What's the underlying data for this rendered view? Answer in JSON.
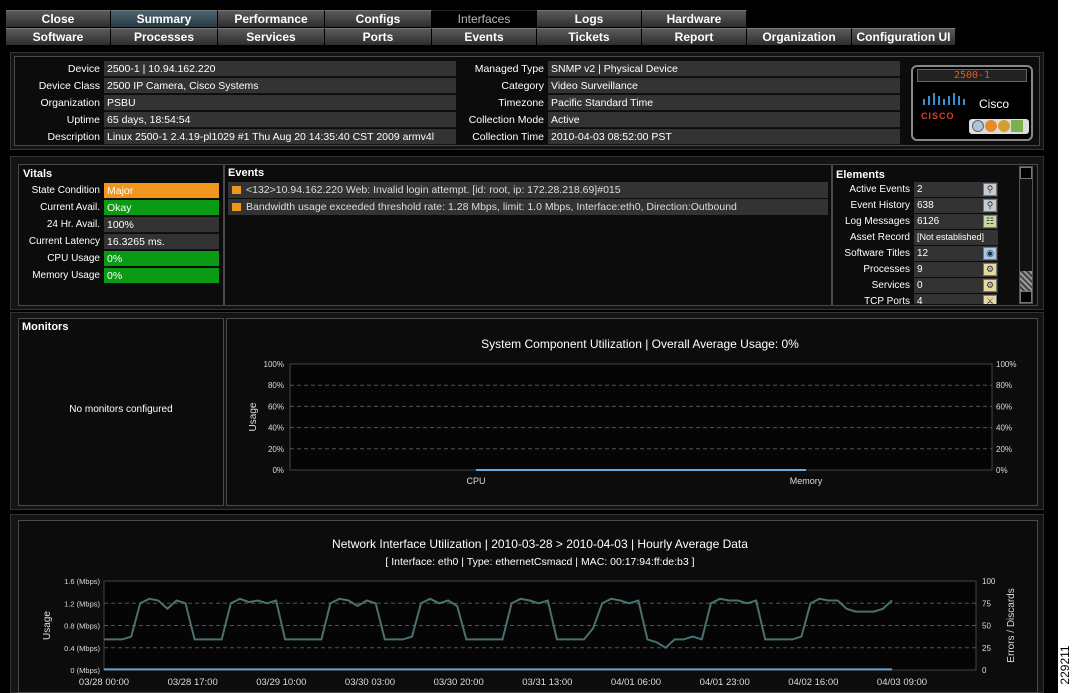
{
  "tabs_row1": [
    {
      "label": "Close",
      "state": "normal"
    },
    {
      "label": "Summary",
      "state": "selected"
    },
    {
      "label": "Performance",
      "state": "normal"
    },
    {
      "label": "Configs",
      "state": "normal"
    },
    {
      "label": "Interfaces",
      "state": "inactive"
    },
    {
      "label": "Logs",
      "state": "normal"
    },
    {
      "label": "Hardware",
      "state": "normal"
    }
  ],
  "tabs_row2": [
    {
      "label": "Software",
      "state": "normal"
    },
    {
      "label": "Processes",
      "state": "normal"
    },
    {
      "label": "Services",
      "state": "normal"
    },
    {
      "label": "Ports",
      "state": "normal"
    },
    {
      "label": "Events",
      "state": "normal"
    },
    {
      "label": "Tickets",
      "state": "normal"
    },
    {
      "label": "Report",
      "state": "normal"
    },
    {
      "label": "Organization",
      "state": "normal"
    },
    {
      "label": "Configuration UI",
      "state": "normal"
    }
  ],
  "device_info": {
    "left": [
      {
        "label": "Device",
        "value": "2500-1 | 10.94.162.220"
      },
      {
        "label": "Device Class",
        "value": "2500 IP Camera, Cisco Systems"
      },
      {
        "label": "Organization",
        "value": "PSBU"
      },
      {
        "label": "Uptime",
        "value": "65 days, 18:54:54"
      },
      {
        "label": "Description",
        "value": "Linux 2500-1 2.4.19-pl1029 #1 Thu Aug 20 14:35:40 CST 2009 armv4l"
      }
    ],
    "right": [
      {
        "label": "Managed Type",
        "value": "SNMP v2 | Physical Device"
      },
      {
        "label": "Category",
        "value": "Video Surveillance"
      },
      {
        "label": "Timezone",
        "value": "Pacific Standard Time"
      },
      {
        "label": "Collection Mode",
        "value": "Active"
      },
      {
        "label": "Collection Time",
        "value": "2010-04-03 08:52:00 PST"
      }
    ],
    "badge_name": "2500-1",
    "badge_logo": "CISCO",
    "badge_vendor": "Cisco"
  },
  "vitals": {
    "title": "Vitals",
    "rows": [
      {
        "label": "State Condition",
        "value": "Major",
        "color": "#f0961e"
      },
      {
        "label": "Current Avail.",
        "value": "Okay",
        "color": "#0a9a14"
      },
      {
        "label": "24 Hr. Avail.",
        "value": "100%",
        "color": "#333333"
      },
      {
        "label": "Current Latency",
        "value": "16.3265 ms.",
        "color": "#333333"
      },
      {
        "label": "CPU Usage",
        "value": "0%",
        "color": "#0a9a14"
      },
      {
        "label": "Memory Usage",
        "value": "0%",
        "color": "#0a9a14"
      }
    ]
  },
  "events": {
    "title": "Events",
    "items": [
      "<132>10.94.162.220 Web: Invalid login attempt. [id: root, ip: 172.28.218.69]#015",
      "Bandwidth usage exceeded threshold rate: 1.28 Mbps, limit: 1.0 Mbps, Interface:eth0, Direction:Outbound"
    ]
  },
  "elements": {
    "title": "Elements",
    "rows": [
      {
        "label": "Active Events",
        "value": "2",
        "icon": "magnifier-icon"
      },
      {
        "label": "Event History",
        "value": "638",
        "icon": "magnifier-icon"
      },
      {
        "label": "Log Messages",
        "value": "6126",
        "icon": "document-icon"
      },
      {
        "label": "Asset Record",
        "value": "[Not established]",
        "icon": ""
      },
      {
        "label": "Software Titles",
        "value": "12",
        "icon": "disc-icon"
      },
      {
        "label": "Processes",
        "value": "9",
        "icon": "gear-icon"
      },
      {
        "label": "Services",
        "value": "0",
        "icon": "gear-icon"
      },
      {
        "label": "TCP Ports",
        "value": "4",
        "icon": "plug-icon"
      }
    ]
  },
  "monitors": {
    "title": "Monitors",
    "empty_text": "No monitors configured"
  },
  "chart_data": [
    {
      "type": "area",
      "title": "System Component Utilization | Overall Average Usage: 0%",
      "ylabel": "Usage",
      "yticks": [
        "100%",
        "80%",
        "60%",
        "40%",
        "20%",
        "0%"
      ],
      "ylim": [
        0,
        100
      ],
      "categories": [
        "CPU",
        "Memory"
      ],
      "values": [
        0,
        0
      ],
      "grid": true
    },
    {
      "type": "line",
      "title": "Network Interface Utilization  | 2010-03-28 > 2010-04-03  | Hourly Average Data",
      "subtitle": "[ Interface: eth0 | Type: ethernetCsmacd | MAC: 00:17:94:ff:de:b3 ]",
      "ylabel": "Usage",
      "y2label": "Errors / Discards",
      "yticks": [
        "1.6 (Mbps)",
        "1.2 (Mbps)",
        "0.8 (Mbps)",
        "0.4 (Mbps)",
        "0 (Mbps)"
      ],
      "y2ticks": [
        "100",
        "75",
        "50",
        "25",
        "0"
      ],
      "ylim": [
        0,
        1.6
      ],
      "xticks": [
        "03/28 00:00",
        "03/28 17:00",
        "03/29 10:00",
        "03/30 03:00",
        "03/30 20:00",
        "03/31 13:00",
        "04/01 06:00",
        "04/01 23:00",
        "04/02 16:00",
        "04/03 09:00"
      ],
      "series": [
        {
          "color": "#4a7070",
          "values": [
            0.55,
            0.55,
            0.55,
            0.6,
            1.2,
            1.28,
            1.25,
            1.1,
            1.25,
            1.2,
            0.55,
            0.55,
            0.55,
            0.55,
            1.2,
            1.28,
            1.22,
            1.25,
            1.2,
            1.25,
            0.55,
            0.55,
            0.55,
            0.55,
            0.55,
            1.2,
            1.28,
            1.25,
            1.15,
            1.25,
            1.2,
            0.55,
            0.55,
            0.55,
            0.6,
            1.2,
            1.28,
            1.2,
            1.25,
            1.15,
            0.55,
            0.55,
            0.55,
            0.55,
            0.55,
            1.2,
            1.28,
            1.25,
            1.2,
            1.25,
            0.55,
            0.55,
            0.55,
            0.55,
            0.75,
            1.2,
            1.28,
            1.25,
            1.2,
            1.25,
            0.55,
            0.5,
            0.4,
            0.55,
            0.55,
            0.6,
            0.55,
            1.2,
            1.28,
            1.25,
            1.25,
            1.2,
            1.25,
            0.55,
            0.55,
            0.55,
            0.55,
            0.6,
            1.2,
            1.28,
            1.25,
            1.25,
            1.1,
            1.05,
            1.05,
            1.05,
            1.1,
            1.25
          ]
        },
        {
          "color": "#6aa0c8",
          "values": [
            0.01,
            0.01,
            0.01,
            0.01,
            0.01,
            0.01,
            0.01,
            0.01,
            0.01,
            0.01,
            0.01,
            0.01,
            0.01,
            0.01,
            0.01,
            0.01,
            0.01,
            0.01,
            0.01,
            0.01,
            0.01,
            0.01,
            0.01,
            0.01,
            0.01,
            0.01,
            0.01,
            0.01,
            0.01,
            0.01,
            0.01,
            0.01,
            0.01,
            0.01,
            0.01,
            0.01,
            0.01,
            0.01,
            0.01,
            0.01,
            0.01,
            0.01,
            0.01,
            0.01,
            0.01,
            0.01,
            0.01,
            0.01,
            0.01,
            0.01,
            0.01,
            0.01,
            0.01,
            0.01,
            0.01,
            0.01,
            0.01,
            0.01,
            0.01,
            0.01,
            0.01,
            0.01,
            0.01,
            0.01,
            0.01,
            0.01,
            0.01,
            0.01,
            0.01,
            0.01,
            0.01,
            0.01,
            0.01,
            0.01,
            0.01,
            0.01,
            0.01,
            0.01,
            0.01,
            0.01,
            0.01,
            0.01,
            0.01,
            0.01,
            0.01,
            0.01,
            0.01,
            0.01
          ]
        }
      ],
      "grid": true
    }
  ],
  "side_id": "229211"
}
